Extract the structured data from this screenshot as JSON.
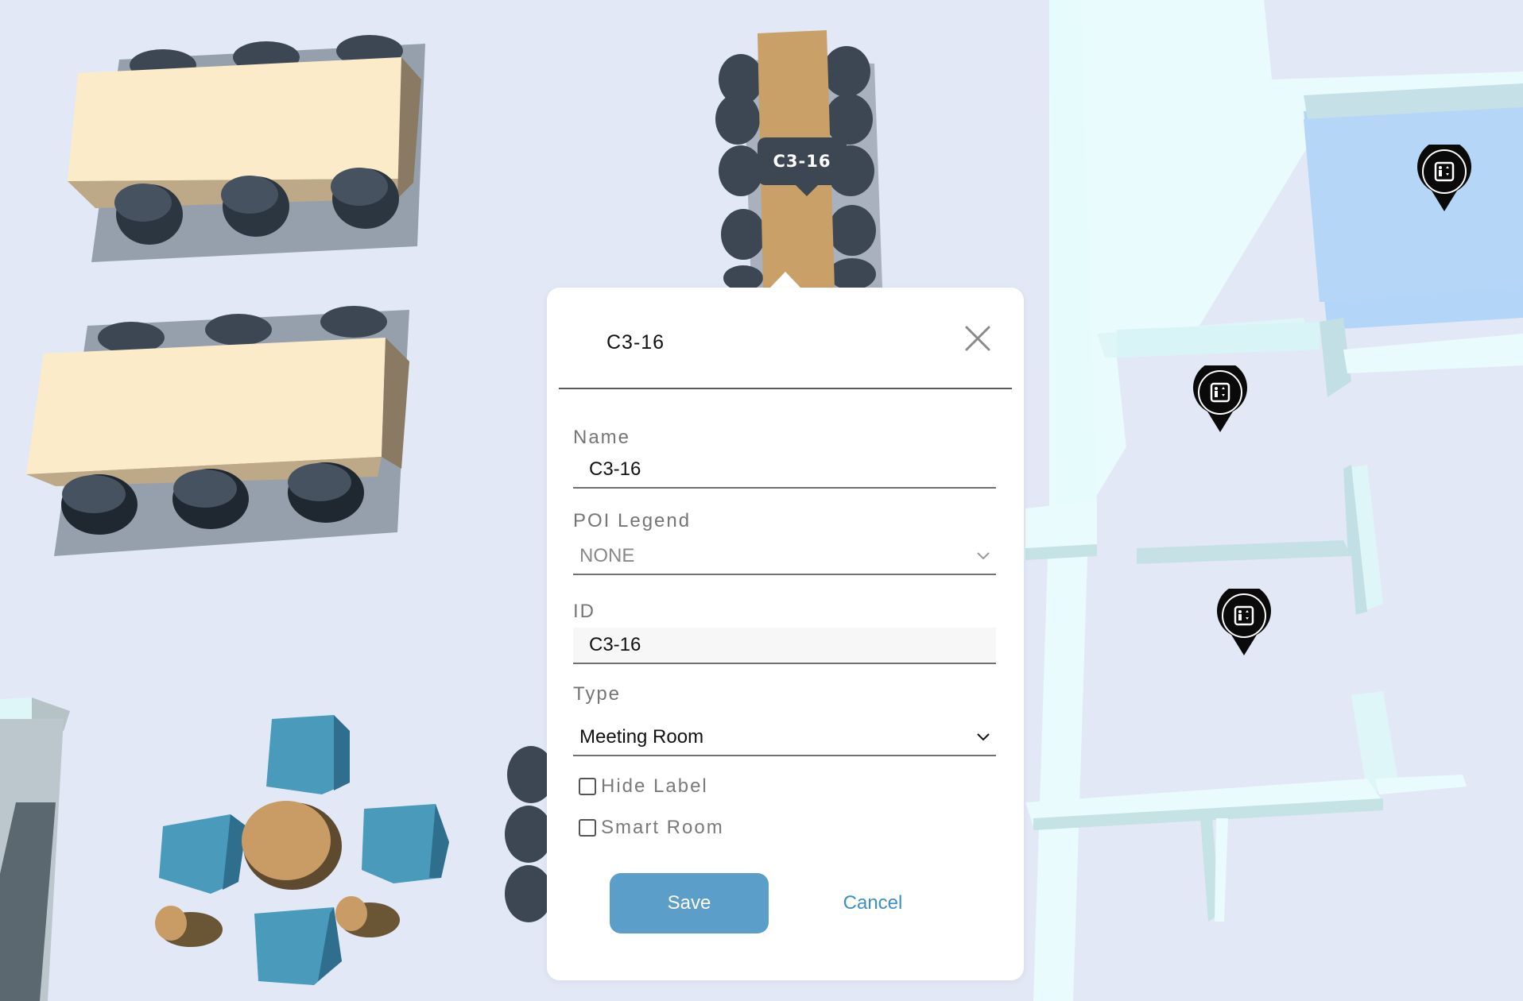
{
  "map": {
    "room_label": "C3-16",
    "pins": [
      {
        "icon": "elevator-icon"
      },
      {
        "icon": "elevator-icon"
      },
      {
        "icon": "elevator-icon"
      }
    ]
  },
  "dialog": {
    "title": "C3-16",
    "close_icon": "close-icon",
    "fields": {
      "name": {
        "label": "Name",
        "value": "C3-16"
      },
      "poi_legend": {
        "label": "POI Legend",
        "value": "NONE"
      },
      "id": {
        "label": "ID",
        "value": "C3-16"
      },
      "type": {
        "label": "Type",
        "value": "Meeting Room"
      }
    },
    "checkboxes": {
      "hide_label": {
        "label": "Hide Label",
        "checked": false
      },
      "smart_room": {
        "label": "Smart Room",
        "checked": false
      }
    },
    "save_label": "Save",
    "cancel_label": "Cancel"
  },
  "colors": {
    "map_background": "#e3e8f7",
    "save_button": "#5b9ec9",
    "cancel_link": "#3d8fc6",
    "label_bubble": "#3d4754"
  }
}
